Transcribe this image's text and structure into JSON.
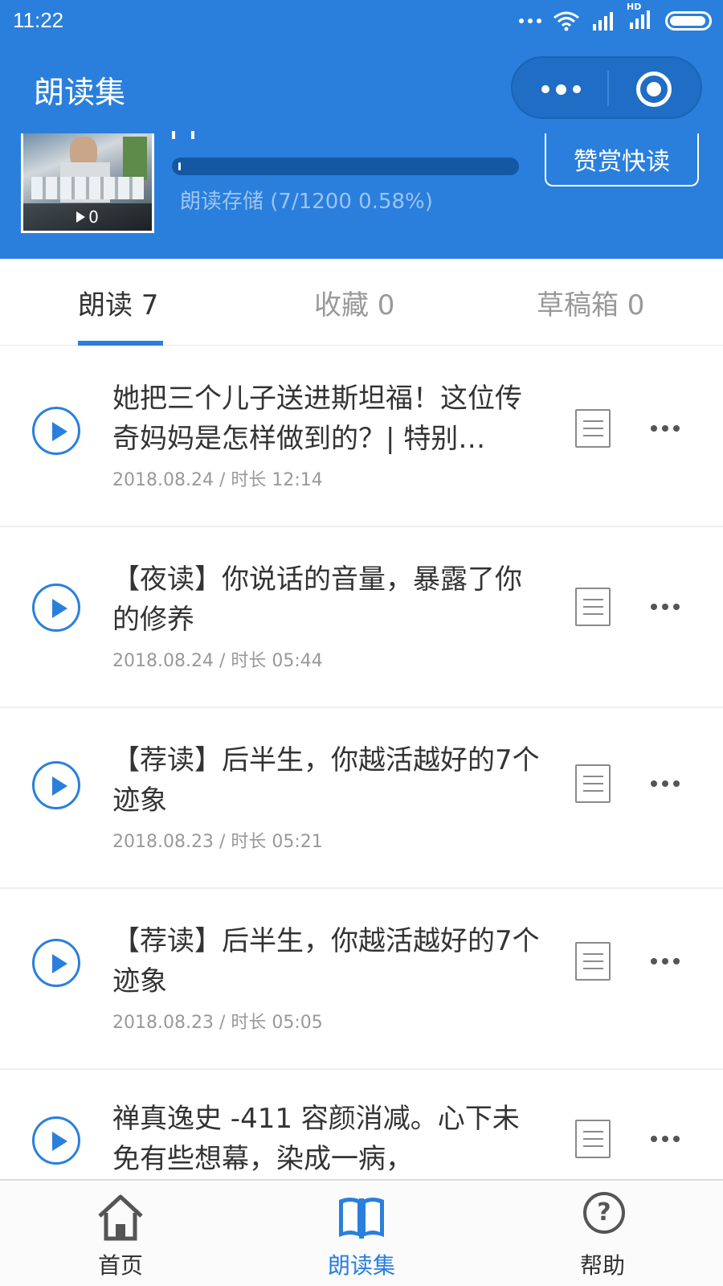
{
  "status_bar": {
    "time": "11:22",
    "hd": "HD"
  },
  "header": {
    "title": "朗读集"
  },
  "profile": {
    "play_count": "0",
    "storage_text": "朗读存储 (7/1200 0.58%)",
    "storage_fraction": 0.0058,
    "reward_button": "赞赏快读"
  },
  "tabs": [
    {
      "label": "朗读 7",
      "active": true
    },
    {
      "label": "收藏 0",
      "active": false
    },
    {
      "label": "草稿箱 0",
      "active": false
    }
  ],
  "items": [
    {
      "title": "她把三个儿子送进斯坦福！这位传奇妈妈是怎样做到的？| 特别…",
      "meta": "2018.08.24 / 时长 12:14"
    },
    {
      "title": "【夜读】你说话的音量，暴露了你的修养",
      "meta": "2018.08.24 / 时长 05:44"
    },
    {
      "title": "【荐读】后半生，你越活越好的7个迹象",
      "meta": "2018.08.23 / 时长 05:21"
    },
    {
      "title": "【荐读】后半生，你越活越好的7个迹象",
      "meta": "2018.08.23 / 时长 05:05"
    },
    {
      "title": "禅真逸史 -411 容颜消减。心下未免有些想幕，染成一病，",
      "meta": ""
    }
  ],
  "bottom_nav": [
    {
      "label": "首页",
      "icon": "home-icon",
      "active": false
    },
    {
      "label": "朗读集",
      "icon": "book-icon",
      "active": true
    },
    {
      "label": "帮助",
      "icon": "help-icon",
      "active": false
    }
  ],
  "colors": {
    "primary": "#2a7fdc",
    "text": "#333333",
    "muted": "#999999"
  }
}
